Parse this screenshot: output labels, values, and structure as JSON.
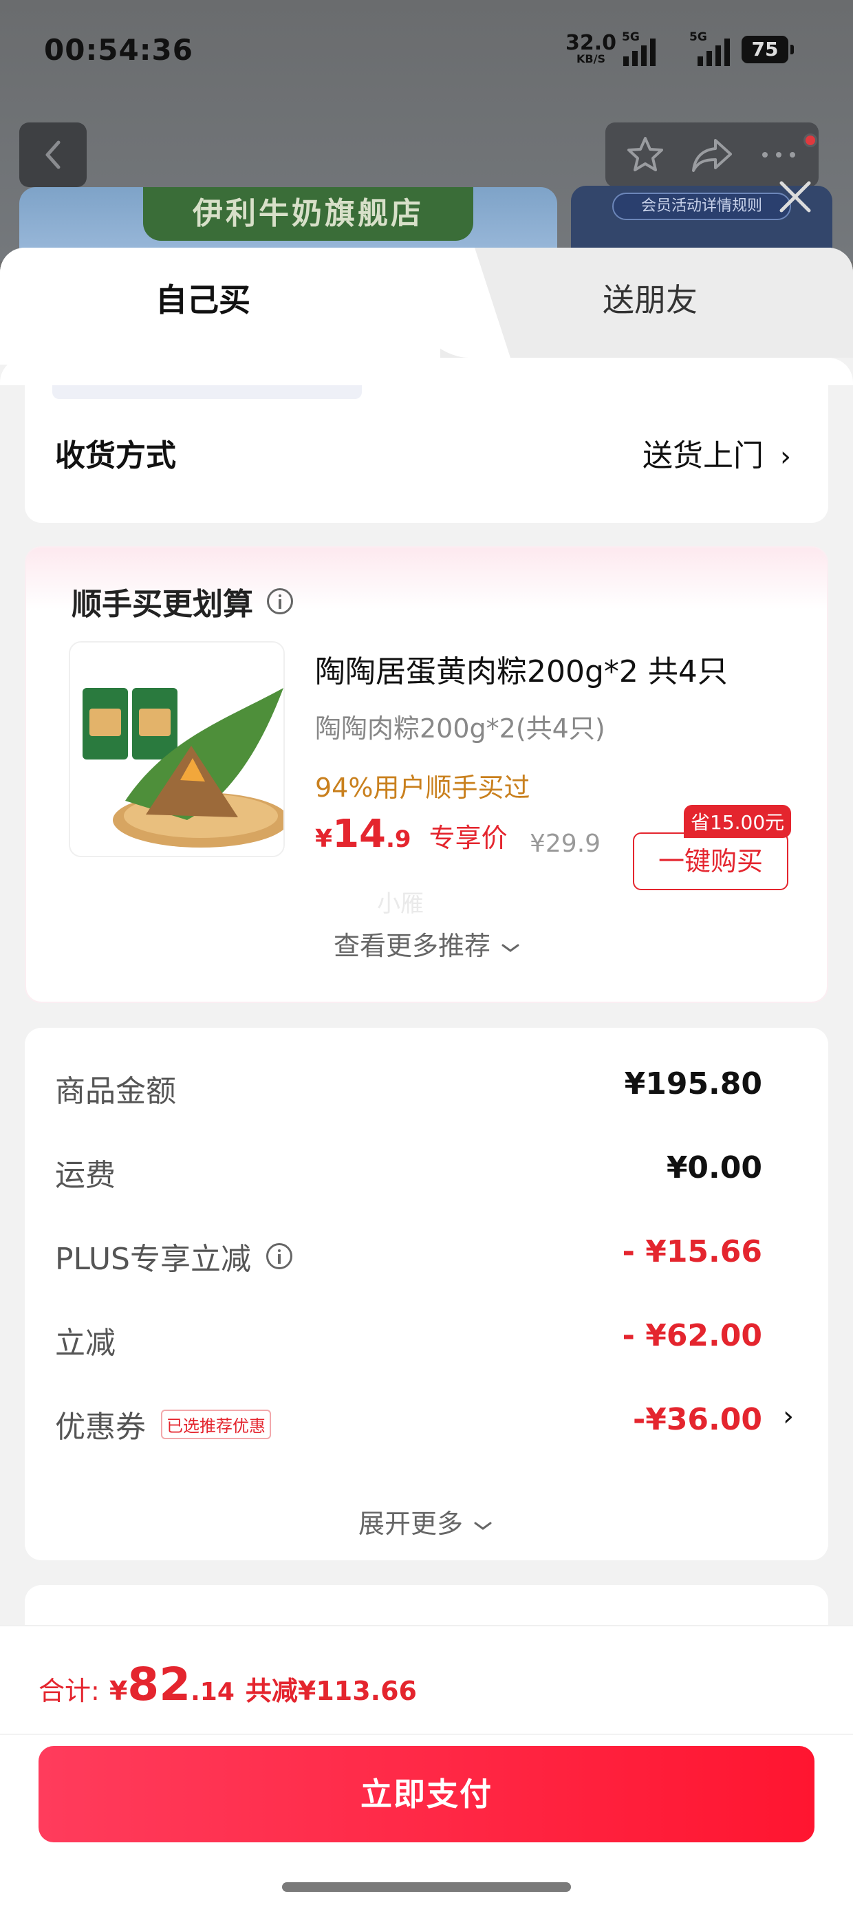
{
  "status_bar": {
    "time": "00:54:36",
    "net_speed": "32.0",
    "net_unit": "KB/S",
    "sim1": "5G",
    "sim2": "5G",
    "battery": "75"
  },
  "background_page": {
    "store_name": "伊利牛奶旗舰店",
    "promo_rule": "会员活动详情规则"
  },
  "tabs": {
    "self": "自己买",
    "friend": "送朋友"
  },
  "delivery": {
    "label": "收货方式",
    "value": "送货上门"
  },
  "recommend": {
    "title": "顺手买更划算",
    "product_name": "陶陶居蛋黄肉粽200g*2 共4只",
    "product_spec": "陶陶肉粽200g*2(共4只)",
    "buy_hint": "94%用户顺手买过",
    "price_currency": "¥",
    "price_int": "14",
    "price_dec": ".9",
    "price_label": "专享价",
    "original_price": "¥29.9",
    "save_tag": "省15.00元",
    "buy_button": "一键购买",
    "watermark": "小雁",
    "more": "查看更多推荐"
  },
  "price_detail": {
    "rows": [
      {
        "label": "商品金额",
        "value": "¥195.80"
      },
      {
        "label": "运费",
        "value": "¥0.00"
      },
      {
        "label": "PLUS专享立减",
        "value": "- ¥15.66"
      },
      {
        "label": "立减",
        "value": "- ¥62.00"
      },
      {
        "label": "优惠券",
        "badge": "已选推荐优惠",
        "value": "-¥36.00"
      }
    ],
    "expand": "展开更多"
  },
  "footer": {
    "total_label": "合计:",
    "currency": "¥",
    "total_int": "82",
    "total_dec": ".14",
    "reduced": "共减¥113.66",
    "pay_button": "立即支付"
  },
  "colors": {
    "accent": "#e4252e",
    "hint": "#c9801e",
    "pay_start": "#ff3c5c",
    "pay_end": "#ff1530"
  }
}
